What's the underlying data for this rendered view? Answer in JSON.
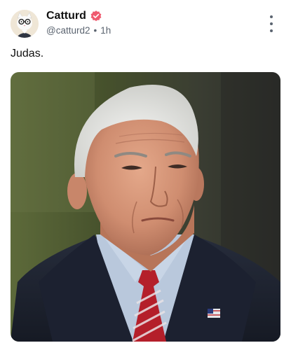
{
  "post": {
    "author": {
      "name": "Catturd",
      "handle": "@catturd2",
      "time": "1h",
      "verified": true,
      "avatar_icon": "cat-with-glasses-avatar"
    },
    "separator": "•",
    "text": "Judas.",
    "media": {
      "type": "photo",
      "icon": "portrait-photo"
    },
    "more_icon": "more-vertical-icon",
    "colors": {
      "verified_badge": "#ef5a6f",
      "meta_text": "#5b6470"
    }
  }
}
